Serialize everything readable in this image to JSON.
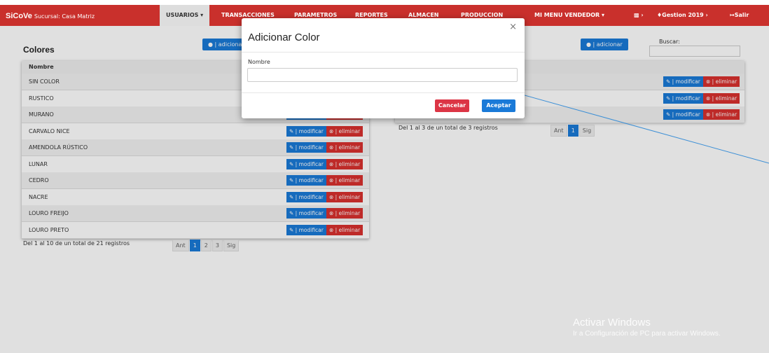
{
  "navbar": {
    "brand_name": "SiCoVe",
    "brand_sub": "Sucursal: Casa Matriz",
    "items": [
      "USUARIOS ▾",
      "TRANSACCIONES",
      "PARAMETROS",
      "REPORTES",
      "ALMACEN",
      "PRODUCCION",
      "MI MENU VENDEDOR ▾"
    ],
    "extra_icon": "printer-icon",
    "gestion": "Gestion 2019",
    "salir": "Salir",
    "bg_color": "#c9302c"
  },
  "left_panel": {
    "title": "Colores",
    "add_label": "| adicionar",
    "column_header": "Nombre",
    "rows": [
      "SIN COLOR",
      "RUSTICO",
      "MURANO",
      "CARVALO NICE",
      "AMENDOLA RÚSTICO",
      "LUNAR",
      "CEDRO",
      "NACRE",
      "LOURO FREIJO",
      "LOURO PRETO"
    ],
    "modify_label": "| modificar",
    "delete_label": "| eliminar",
    "footer": "Del 1 al 10 de un total de 21 registros",
    "pager": [
      "Ant",
      "1",
      "2",
      "3",
      "Sig"
    ]
  },
  "right_panel": {
    "add_label": "| adicionar",
    "search_label": "Buscar:",
    "modify_label": "| modificar",
    "delete_label": "| eliminar",
    "footer": "Del 1 al 3 de un total de 3 registros",
    "pager": [
      "Ant",
      "1",
      "Sig"
    ]
  },
  "modal": {
    "title": "Adicionar Color",
    "close": "×",
    "label": "Nombre",
    "input_value": "",
    "cancel": "Cancelar",
    "accept": "Aceptar"
  },
  "watermark": {
    "line1": "Activar Windows",
    "line2": "Ir a Configuración de PC para activar Windows."
  }
}
